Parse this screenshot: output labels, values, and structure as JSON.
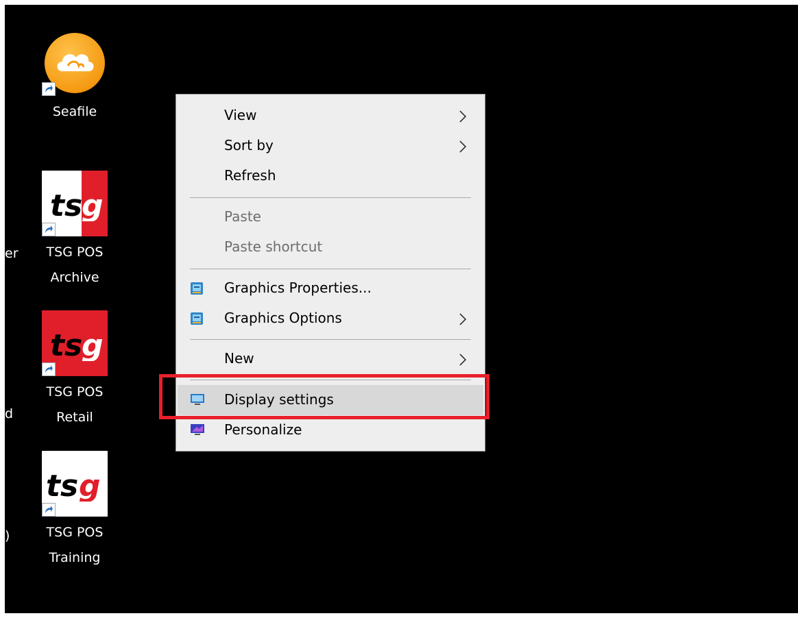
{
  "desktop": {
    "background_color": "#000000",
    "edge_fragments": [
      "er",
      "d",
      ")"
    ],
    "icons": [
      {
        "label_lines": [
          "Seafile"
        ],
        "icon": "seafile-cloud-icon"
      },
      {
        "label_lines": [
          "TSG POS",
          "Archive"
        ],
        "icon": "tsg-logo-icon"
      },
      {
        "label_lines": [
          "TSG POS",
          "Retail"
        ],
        "icon": "tsg-logo-icon"
      },
      {
        "label_lines": [
          "TSG POS",
          "Training"
        ],
        "icon": "tsg-logo-icon"
      }
    ]
  },
  "context_menu": {
    "items": [
      {
        "label": "View",
        "submenu": true,
        "enabled": true
      },
      {
        "label": "Sort by",
        "submenu": true,
        "enabled": true
      },
      {
        "label": "Refresh",
        "submenu": false,
        "enabled": true
      },
      {
        "label": "Paste",
        "submenu": false,
        "enabled": false
      },
      {
        "label": "Paste shortcut",
        "submenu": false,
        "enabled": false
      },
      {
        "label": "Graphics Properties...",
        "submenu": false,
        "enabled": true,
        "icon": "intel-graphics-icon"
      },
      {
        "label": "Graphics Options",
        "submenu": true,
        "enabled": true,
        "icon": "intel-graphics-icon"
      },
      {
        "label": "New",
        "submenu": true,
        "enabled": true
      },
      {
        "label": "Display settings",
        "submenu": false,
        "enabled": true,
        "icon": "monitor-icon",
        "highlighted": true
      },
      {
        "label": "Personalize",
        "submenu": false,
        "enabled": true,
        "icon": "personalize-icon"
      }
    ]
  },
  "colors": {
    "menu_background": "#eeeeee",
    "menu_hover": "#d8d8d8",
    "disabled_text": "#6d6d6d",
    "annotation_red": "#e8202a",
    "tsg_red": "#e11f2a"
  }
}
